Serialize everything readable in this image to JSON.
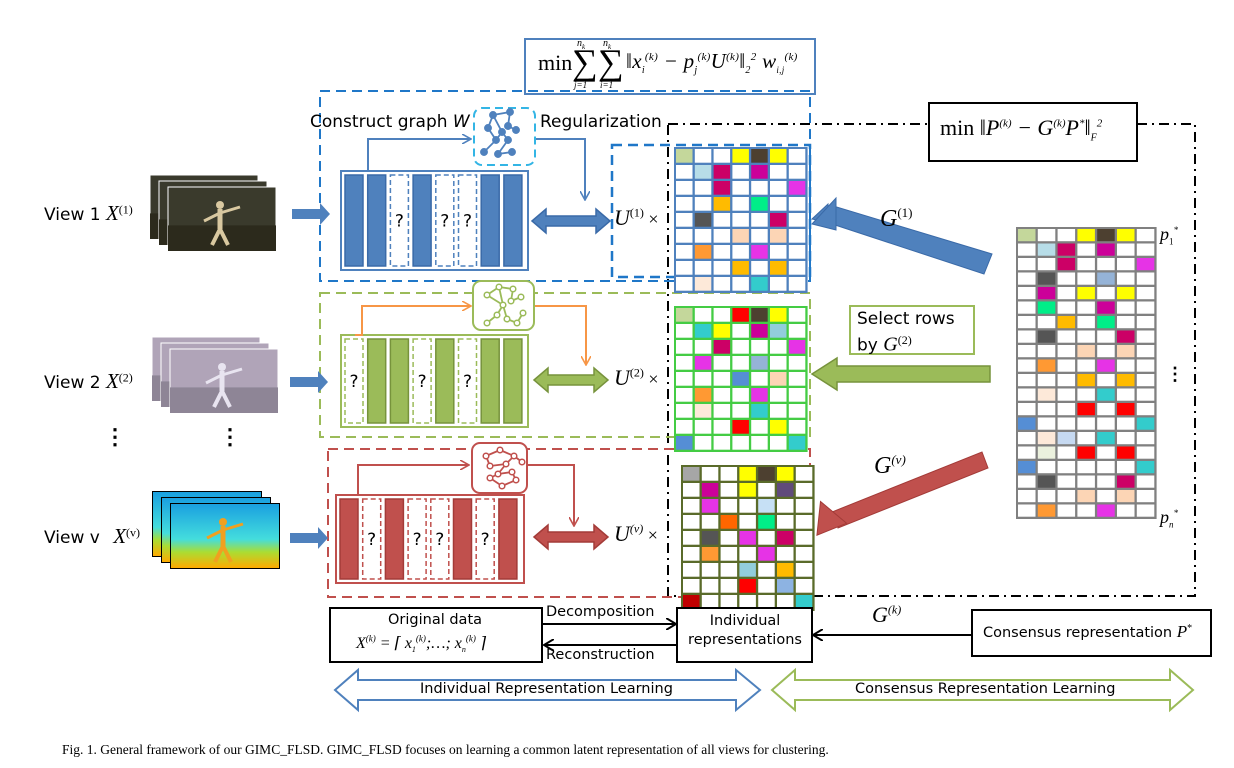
{
  "objective_top": {
    "prefix": "min",
    "sum_upper": "n",
    "sum_upper_sub": "k",
    "sum1_lower": "j=1",
    "sum2_lower": "i=1",
    "body": "‖x_i^(k) − p_j^(k) U^(k)‖₂² w_{i,j}^(k)"
  },
  "objective_right": {
    "prefix": "min",
    "body": "‖P^(k) − G^(k) P*‖_F²"
  },
  "labels": {
    "construct_graph": "Construct graph ",
    "construct_graph_var": "W",
    "regularization": "Regularization",
    "select_rows_line1": "Select rows",
    "select_rows_line2": "by ",
    "select_rows_var": "G",
    "select_rows_sup": "(2)",
    "vdots": "⋮",
    "p1": "p",
    "p1_sub": "1",
    "pn": "p",
    "pn_sub": "n",
    "star": "*"
  },
  "views": [
    {
      "label": "View 1 ",
      "var": "X",
      "sup": "(1)",
      "color": "#4f81bd",
      "border": "#3a6aa8",
      "u_sup": "(1)",
      "g_sup": "(1)",
      "columns": [
        "f",
        "f",
        "m",
        "f",
        "m",
        "m",
        "f",
        "f"
      ],
      "grid_border": "#4f81bd"
    },
    {
      "label": "View 2 ",
      "var": "X",
      "sup": "(2)",
      "color": "#9bbb59",
      "border": "#77933c",
      "u_sup": "(2)",
      "g_sup": "(2)",
      "columns": [
        "m",
        "f",
        "f",
        "m",
        "f",
        "m",
        "f",
        "f"
      ],
      "grid_border": "#44cc44"
    },
    {
      "label": "View v ",
      "var": "X",
      "sup": "(v)",
      "color": "#c0504d",
      "border": "#a33b38",
      "u_sup": "(v)",
      "g_sup": "(v)",
      "columns": [
        "f",
        "m",
        "f",
        "m",
        "m",
        "f",
        "m",
        "f"
      ],
      "grid_border": "#5a6b2a"
    }
  ],
  "missing_mark": "?",
  "times": "×",
  "U": "U",
  "G": "G",
  "grids": [
    [
      [
        "#c4d79b",
        "",
        "",
        "#ffff00",
        "#4d4030",
        "#ffff00",
        ""
      ],
      [
        "",
        "#b7dde8",
        "#cc0066",
        "",
        "#cc0099",
        "",
        ""
      ],
      [
        "",
        "",
        "#cc0066",
        "",
        "",
        "",
        "#e633e6"
      ],
      [
        "",
        "",
        "#ffbb00",
        "",
        "#00ee88",
        "",
        ""
      ],
      [
        "",
        "#555555",
        "",
        "",
        "",
        "#cc0066",
        ""
      ],
      [
        "",
        "",
        "",
        "#fcd5b5",
        "",
        "#fcd5b5",
        ""
      ],
      [
        "",
        "#ff9933",
        "",
        "",
        "#e633e6",
        "",
        ""
      ],
      [
        "",
        "",
        "",
        "#ffbb00",
        "",
        "#ffbb00",
        ""
      ],
      [
        "",
        "#fde9d9",
        "",
        "",
        "#33cccc",
        "",
        ""
      ]
    ],
    [
      [
        "#c4d79b",
        "",
        "",
        "#ff0000",
        "#4d4030",
        "#ffff00",
        ""
      ],
      [
        "",
        "#33cccc",
        "#ffff00",
        "",
        "#cc0099",
        "#92cddc",
        ""
      ],
      [
        "",
        "",
        "#cc0066",
        "",
        "",
        "",
        "#e633e6"
      ],
      [
        "",
        "#e633e6",
        "",
        "",
        "#95b3d7",
        "",
        ""
      ],
      [
        "",
        "",
        "",
        "#558ed5",
        "",
        "#fcd5b5",
        ""
      ],
      [
        "",
        "#ff9933",
        "",
        "",
        "#e633e6",
        "",
        ""
      ],
      [
        "",
        "#fde9d9",
        "",
        "",
        "#33cccc",
        "",
        ""
      ],
      [
        "",
        "",
        "",
        "#ff0000",
        "",
        "#ffff00",
        ""
      ],
      [
        "#558ed5",
        "",
        "",
        "",
        "",
        "",
        "#33cccc"
      ]
    ],
    [
      [
        "#a6a6a6",
        "",
        "",
        "#ffff00",
        "#4d4030",
        "#ffff00",
        ""
      ],
      [
        "",
        "#cc0099",
        "",
        "#ffff00",
        "",
        "#604a7b",
        ""
      ],
      [
        "",
        "#e633e6",
        "",
        "",
        "#c6e0f5",
        "",
        ""
      ],
      [
        "",
        "",
        "#ff6600",
        "",
        "#00ee88",
        "",
        ""
      ],
      [
        "",
        "#555555",
        "",
        "#e633e6",
        "",
        "#cc0066",
        ""
      ],
      [
        "",
        "#ff9933",
        "",
        "",
        "#e633e6",
        "",
        ""
      ],
      [
        "",
        "",
        "",
        "#92cddc",
        "",
        "#ffbb00",
        ""
      ],
      [
        "",
        "",
        "",
        "#ff0000",
        "",
        "#8db3e2",
        ""
      ],
      [
        "#c00000",
        "",
        "",
        "",
        "",
        "",
        "#33cccc"
      ]
    ]
  ],
  "consensus_grid": [
    [
      "#c4d79b",
      "",
      "",
      "#ffff00",
      "#4d4030",
      "#ffff00",
      ""
    ],
    [
      "",
      "#b7dde8",
      "#cc0066",
      "",
      "#cc0099",
      "",
      ""
    ],
    [
      "",
      "",
      "#cc0066",
      "",
      "",
      "",
      "#e633e6"
    ],
    [
      "",
      "#555555",
      "",
      "",
      "#95b3d7",
      "",
      ""
    ],
    [
      "",
      "#cc0099",
      "",
      "#ffff00",
      "",
      "#ffff00",
      ""
    ],
    [
      "",
      "#00ee88",
      "",
      "",
      "#cc0099",
      "",
      ""
    ],
    [
      "",
      "",
      "#ffbb00",
      "",
      "#00ee88",
      "",
      ""
    ],
    [
      "",
      "#555555",
      "",
      "",
      "",
      "#cc0066",
      ""
    ],
    [
      "",
      "",
      "",
      "#fcd5b5",
      "",
      "#fcd5b5",
      ""
    ],
    [
      "",
      "#ff9933",
      "",
      "",
      "#e633e6",
      "",
      ""
    ],
    [
      "",
      "",
      "",
      "#ffbb00",
      "",
      "#ffbb00",
      ""
    ],
    [
      "",
      "#fde9d9",
      "",
      "",
      "#33cccc",
      "",
      ""
    ],
    [
      "",
      "",
      "",
      "#ff0000",
      "",
      "#ff0000",
      ""
    ],
    [
      "#558ed5",
      "",
      "",
      "",
      "",
      "",
      "#33cccc"
    ],
    [
      "",
      "#fde9d9",
      "#c6d9f1",
      "",
      "#33cccc",
      "",
      ""
    ],
    [
      "",
      "#ebf1de",
      "",
      "#ff0000",
      "",
      "#ff0000",
      ""
    ],
    [
      "#558ed5",
      "",
      "",
      "",
      "",
      "",
      "#33cccc"
    ],
    [
      "",
      "#555555",
      "",
      "",
      "",
      "#cc0066",
      ""
    ],
    [
      "",
      "",
      "",
      "#fcd5b5",
      "",
      "#fcd5b5",
      ""
    ],
    [
      "",
      "#ff9933",
      "",
      "",
      "#e633e6",
      "",
      ""
    ]
  ],
  "bottom": {
    "original_data_title": "Original data",
    "original_data_formula": "X^(k) = [ x_1^(k); … ; x_n^(k) ]",
    "decomposition": "Decomposition",
    "reconstruction": "Reconstruction",
    "individual_line1": "Individual",
    "individual_line2": "representations",
    "gk_var": "G",
    "gk_sup": "(k)",
    "consensus_label": "Consensus representation ",
    "consensus_var": "P",
    "consensus_sup": "*",
    "individual_learning": "Individual Representation Learning",
    "consensus_learning": "Consensus Representation Learning"
  },
  "colors": {
    "blue": "#4f81bd",
    "blue_dash": "#1f77c8",
    "light_blue_dash": "#33b5e5",
    "green": "#9bbb59",
    "red": "#c0504d",
    "orange": "#f79646",
    "grid_gray": "#808080"
  },
  "caption": "Fig. 1.   General framework of our GIMC_FLSD. GIMC_FLSD focuses on learning a common latent representation of all views for clustering."
}
